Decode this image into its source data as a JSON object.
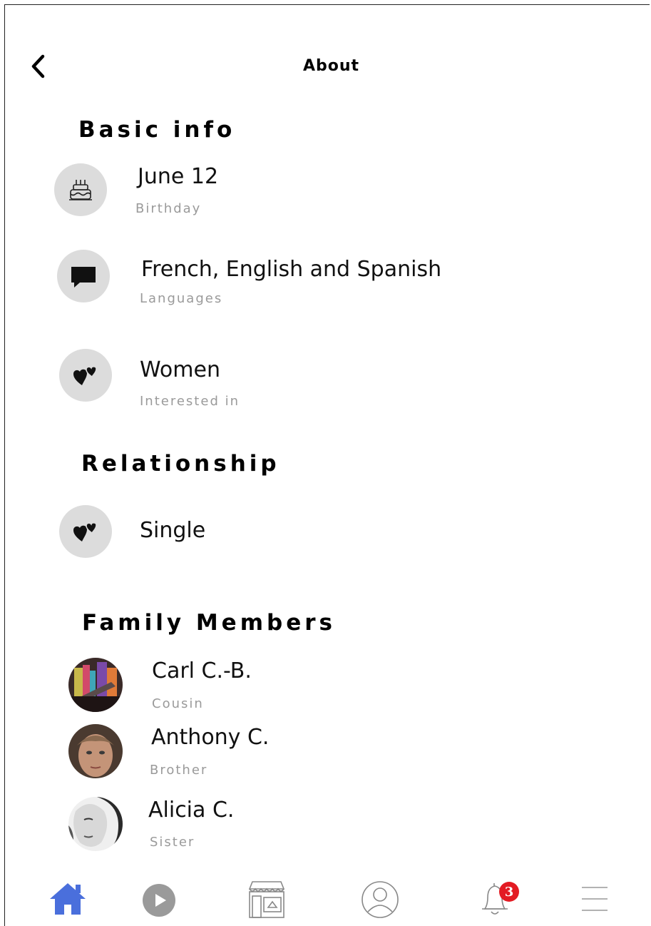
{
  "header": {
    "title": "About"
  },
  "sections": {
    "basic_info": "Basic info",
    "relationship": "Relationship",
    "family": "Family Members"
  },
  "basic_info": [
    {
      "value": "June 12",
      "label": "Birthday",
      "icon": "birthday-cake-icon"
    },
    {
      "value": "French, English and Spanish",
      "label": "Languages",
      "icon": "speech-bubble-icon"
    },
    {
      "value": "Women",
      "label": "Interested in",
      "icon": "hearts-icon"
    }
  ],
  "relationship": {
    "value": "Single",
    "icon": "hearts-icon"
  },
  "family": [
    {
      "name": "Carl C.-B.",
      "relation": "Cousin"
    },
    {
      "name": "Anthony C.",
      "relation": "Brother"
    },
    {
      "name": "Alicia C.",
      "relation": "Sister"
    }
  ],
  "nav": {
    "items": [
      "home-icon",
      "play-icon",
      "marketplace-icon",
      "profile-icon",
      "bell-icon",
      "menu-icon"
    ],
    "notification_count": "3"
  },
  "colors": {
    "accent": "#4a6fdc",
    "badge": "#e31b23",
    "icon_bg": "#dcdcdc",
    "muted": "#9a9a9a"
  }
}
